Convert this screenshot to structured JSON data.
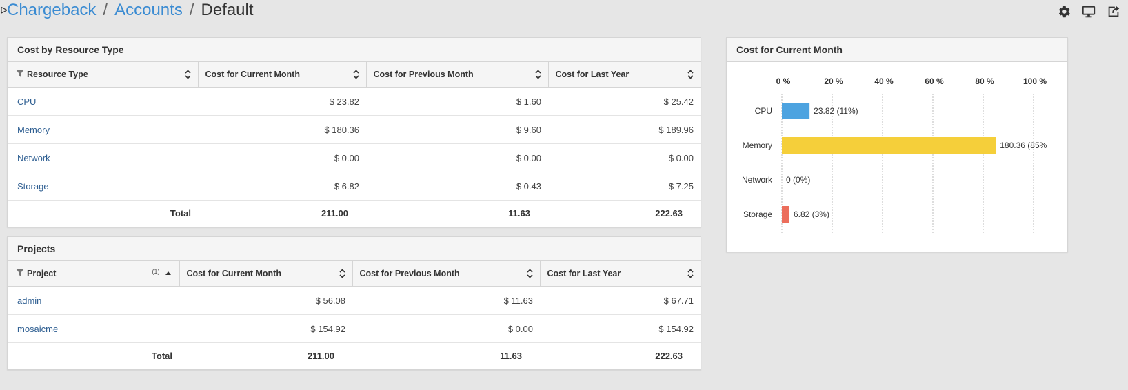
{
  "breadcrumb": {
    "items": [
      "Chargeback",
      "Accounts"
    ],
    "separator": "/",
    "current": "Default"
  },
  "toolbar": {
    "icons": [
      "gear-icon",
      "monitor-icon",
      "export-icon"
    ]
  },
  "resource_panel": {
    "title": "Cost by Resource Type",
    "columns": [
      "Resource Type",
      "Cost for Current Month",
      "Cost for Previous Month",
      "Cost for Last Year"
    ],
    "rows": [
      {
        "name": "CPU",
        "current": "$ 23.82",
        "previous": "$ 1.60",
        "last_year": "$ 25.42"
      },
      {
        "name": "Memory",
        "current": "$ 180.36",
        "previous": "$ 9.60",
        "last_year": "$ 189.96"
      },
      {
        "name": "Network",
        "current": "$ 0.00",
        "previous": "$ 0.00",
        "last_year": "$ 0.00"
      },
      {
        "name": "Storage",
        "current": "$ 6.82",
        "previous": "$ 0.43",
        "last_year": "$ 7.25"
      }
    ],
    "total": {
      "label": "Total",
      "current": "211.00",
      "previous": "11.63",
      "last_year": "222.63"
    }
  },
  "projects_panel": {
    "title": "Projects",
    "columns": [
      "Project",
      "Cost for Current Month",
      "Cost for Previous Month",
      "Cost for Last Year"
    ],
    "sort_order": "(1)",
    "rows": [
      {
        "name": "admin",
        "current": "$ 56.08",
        "previous": "$ 11.63",
        "last_year": "$ 67.71"
      },
      {
        "name": "mosaicme",
        "current": "$ 154.92",
        "previous": "$ 0.00",
        "last_year": "$ 154.92"
      }
    ],
    "total": {
      "label": "Total",
      "current": "211.00",
      "previous": "11.63",
      "last_year": "222.63"
    }
  },
  "chart_panel": {
    "title": "Cost for Current Month"
  },
  "colors": {
    "link": "#3a8bd2",
    "row_link": "#2f5f92",
    "cpu": "#4da3e0",
    "memory": "#f5cf3a",
    "network": "#7fb47f",
    "storage": "#ec6e5c"
  },
  "chart_data": {
    "type": "bar",
    "orientation": "horizontal",
    "title": "Cost for Current Month",
    "categories": [
      "CPU",
      "Memory",
      "Network",
      "Storage"
    ],
    "values": [
      23.82,
      180.36,
      0,
      6.82
    ],
    "percents": [
      11,
      85,
      0,
      3
    ],
    "data_labels": [
      "23.82 (11%)",
      "180.36 (85%",
      "0 (0%)",
      "6.82 (3%)"
    ],
    "tick_labels": [
      "0 %",
      "20 %",
      "40 %",
      "60 %",
      "80 %",
      "100 %"
    ],
    "xlim": [
      0,
      100
    ],
    "grid": true,
    "legend": "none"
  }
}
